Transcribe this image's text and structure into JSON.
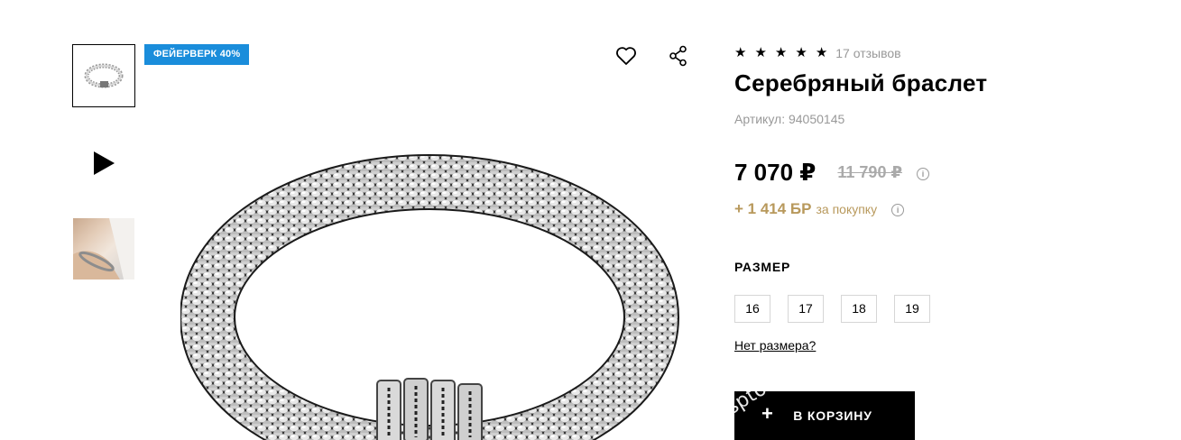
{
  "thumbnails": [
    {
      "kind": "image",
      "icon": "bracelet-thumbnail"
    },
    {
      "kind": "video",
      "icon": "play-icon"
    },
    {
      "kind": "image",
      "icon": "wrist-photo-thumbnail"
    }
  ],
  "badge": {
    "label": "ФЕЙЕРВЕРК 40%",
    "color": "#1a8ddb"
  },
  "actions": {
    "favorite_icon": "heart-icon",
    "share_icon": "share-icon"
  },
  "product": {
    "rating": 5,
    "reviews": "17 отзывов",
    "title": "Серебряный браслет",
    "article_label": "Артикул: ",
    "article_value": "94050145",
    "price": "7 070 ₽",
    "old_price": "11 790 ₽",
    "bonus_value": "+ 1 414 БР",
    "bonus_label": "за покупку",
    "bonus_color": "#b8995c"
  },
  "size": {
    "title": "РАЗМЕР",
    "options": [
      "16",
      "17",
      "18",
      "19"
    ],
    "no_size_link": "Нет размера?"
  },
  "cart": {
    "label": "В КОРЗИНУ",
    "plus": "+",
    "watermark": "sptovar"
  }
}
